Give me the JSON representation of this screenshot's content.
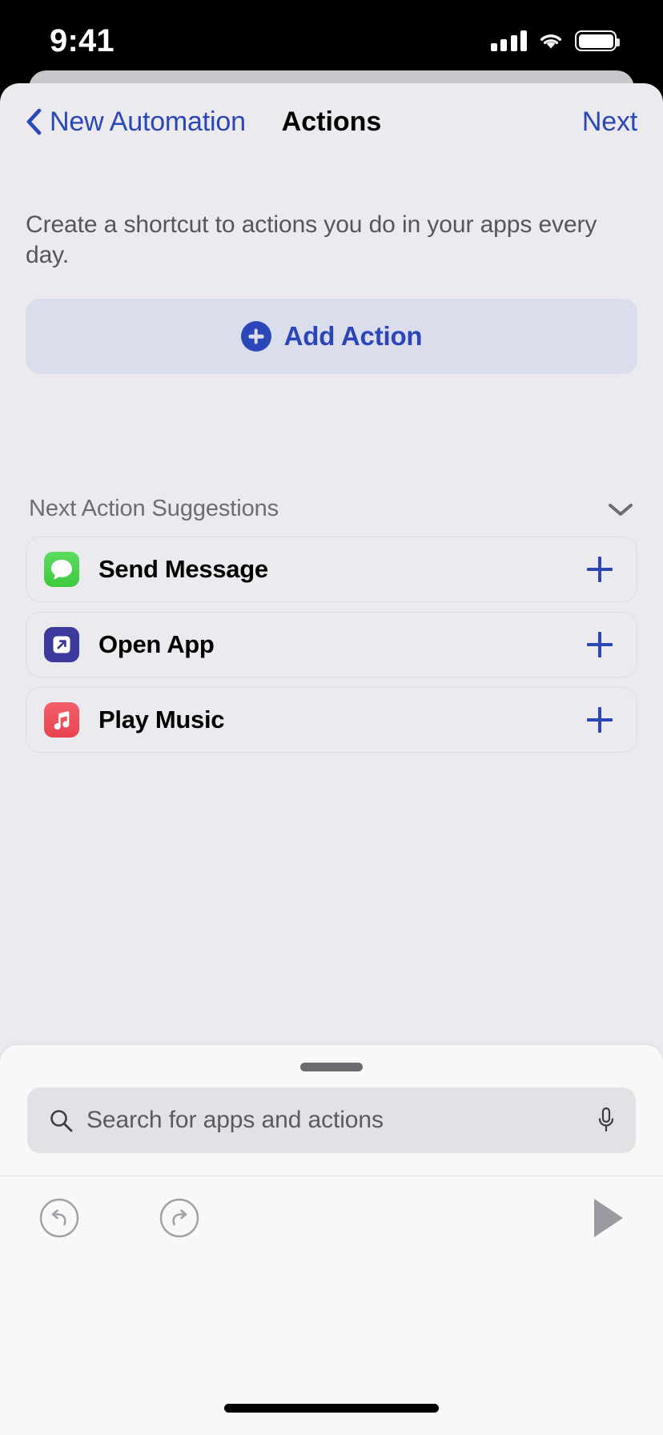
{
  "status_bar": {
    "time": "9:41",
    "cellular_icon": "cellular-bars-icon",
    "wifi_icon": "wifi-icon",
    "battery_icon": "battery-full-icon"
  },
  "navbar": {
    "back_icon": "chevron-left-icon",
    "back_label": "New Automation",
    "title": "Actions",
    "next_label": "Next",
    "tint_color": "#2b46b8"
  },
  "main": {
    "description": "Create a shortcut to actions you do in your apps every day.",
    "add_action": {
      "label": "Add Action",
      "icon": "plus-circle-icon",
      "background": "#dadeec"
    },
    "suggestions": {
      "title": "Next Action Suggestions",
      "collapse_icon": "chevron-down-icon",
      "items": [
        {
          "label": "Send Message",
          "icon": "messages-app-icon",
          "icon_color": "#3ec93f",
          "add_icon": "plus-icon"
        },
        {
          "label": "Open App",
          "icon": "open-app-icon",
          "icon_color": "#3b3b9e",
          "add_icon": "plus-icon"
        },
        {
          "label": "Play Music",
          "icon": "music-app-icon",
          "icon_color": "#e8434f",
          "add_icon": "plus-icon"
        }
      ]
    }
  },
  "bottom_sheet": {
    "grabber": "sheet-grabber",
    "search": {
      "placeholder": "Search for apps and actions",
      "search_icon": "search-icon",
      "mic_icon": "microphone-icon"
    },
    "toolbar": {
      "undo_icon": "undo-icon",
      "redo_icon": "redo-icon",
      "play_icon": "play-icon"
    }
  },
  "home_indicator": "home-indicator"
}
